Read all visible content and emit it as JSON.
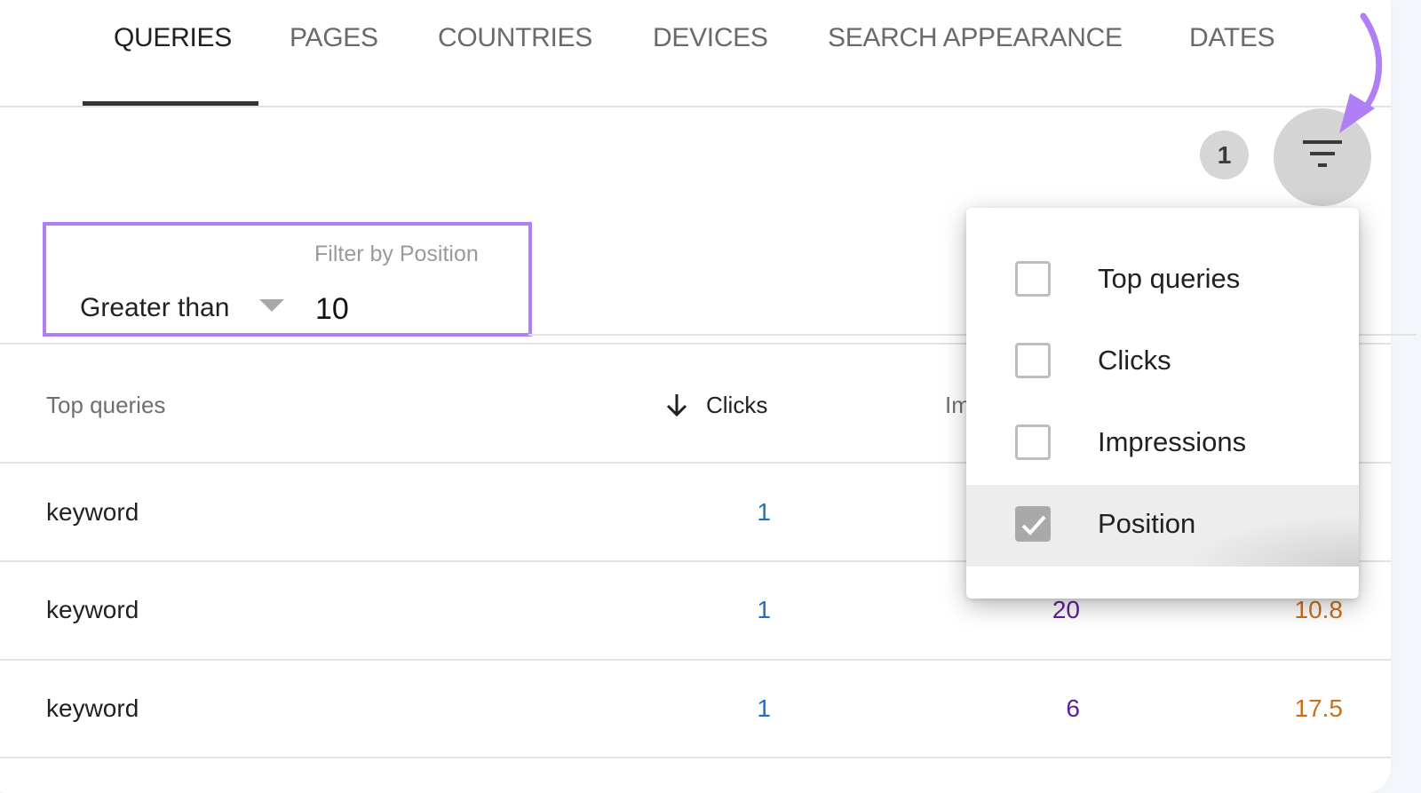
{
  "tabs": [
    {
      "label": "QUERIES",
      "active": true
    },
    {
      "label": "PAGES",
      "active": false
    },
    {
      "label": "COUNTRIES",
      "active": false
    },
    {
      "label": "DEVICES",
      "active": false
    },
    {
      "label": "SEARCH APPEARANCE",
      "active": false
    },
    {
      "label": "DATES",
      "active": false
    }
  ],
  "toolbar": {
    "active_filter_count": "1",
    "filter_button_icon": "filter-list-icon"
  },
  "filter": {
    "label": "Filter by Position",
    "operator": "Greater than",
    "value": "10"
  },
  "table": {
    "columns": [
      "Top queries",
      "Clicks",
      "Impressions",
      "Position"
    ],
    "visible_header_fragment": "Im",
    "sorted_column": "Clicks",
    "sort_direction": "descending",
    "rows": [
      {
        "query": "keyword",
        "clicks": "1",
        "impressions": "",
        "position": ""
      },
      {
        "query": "keyword",
        "clicks": "1",
        "impressions": "20",
        "position": "10.8"
      },
      {
        "query": "keyword",
        "clicks": "1",
        "impressions": "6",
        "position": "17.5"
      }
    ]
  },
  "filter_menu": {
    "items": [
      {
        "label": "Top queries",
        "checked": false
      },
      {
        "label": "Clicks",
        "checked": false
      },
      {
        "label": "Impressions",
        "checked": false
      },
      {
        "label": "Position",
        "checked": true
      }
    ]
  },
  "colors": {
    "annotation": "#b07ff5",
    "clicks": "#1a6fcf",
    "impressions": "#5e1f9c",
    "position": "#c8701f"
  }
}
